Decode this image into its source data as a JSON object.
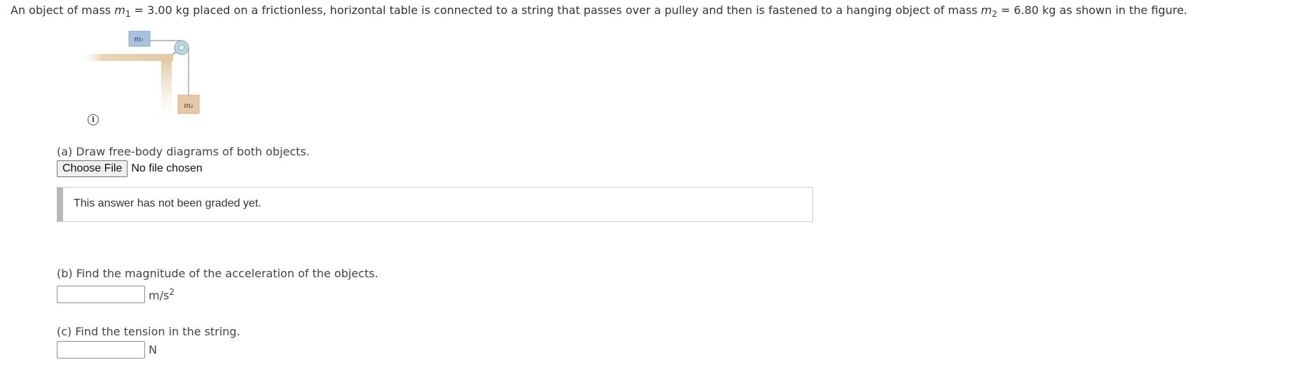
{
  "problem": {
    "text_1": "An object of mass ",
    "m1_symbol": "m",
    "m1_sub": "1",
    "text_2": " = 3.00 kg placed on a frictionless, horizontal table is connected to a string that passes over a pulley and then is fastened to a hanging object of mass ",
    "m2_symbol": "m",
    "m2_sub": "2",
    "text_3": " = 6.80 kg as shown in the figure."
  },
  "figure": {
    "block1_label": "m₁",
    "block2_label": "m₂",
    "info_icon": "info-icon"
  },
  "part_a": {
    "label": "(a) Draw free-body diagrams of both objects.",
    "choose_file": "Choose File",
    "file_status": "No file chosen",
    "graded_message": "This answer has not been graded yet."
  },
  "part_b": {
    "label": "(b) Find the magnitude of the acceleration of the objects.",
    "value": "",
    "unit_base": "m/s",
    "unit_exp": "2"
  },
  "part_c": {
    "label": "(c) Find the tension in the string.",
    "value": "",
    "unit": "N"
  },
  "colors": {
    "block1": "#a8c3df",
    "block2": "#e8c8a4",
    "table": "#e9d5b8",
    "pulley": "#bcd7dd"
  }
}
